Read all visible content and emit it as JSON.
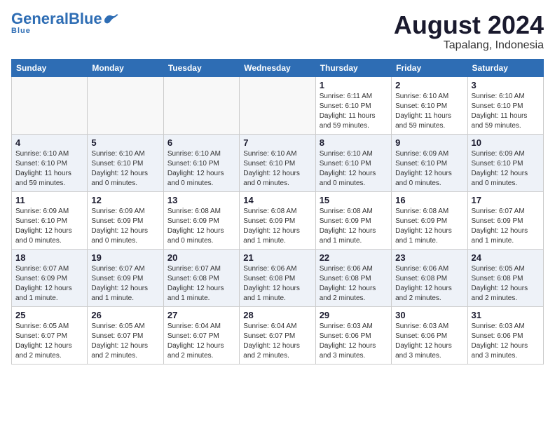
{
  "header": {
    "logo_general": "General",
    "logo_blue": "Blue",
    "month_year": "August 2024",
    "location": "Tapalang, Indonesia"
  },
  "weekdays": [
    "Sunday",
    "Monday",
    "Tuesday",
    "Wednesday",
    "Thursday",
    "Friday",
    "Saturday"
  ],
  "weeks": [
    [
      {
        "day": "",
        "sunrise": "",
        "sunset": "",
        "daylight": ""
      },
      {
        "day": "",
        "sunrise": "",
        "sunset": "",
        "daylight": ""
      },
      {
        "day": "",
        "sunrise": "",
        "sunset": "",
        "daylight": ""
      },
      {
        "day": "",
        "sunrise": "",
        "sunset": "",
        "daylight": ""
      },
      {
        "day": "1",
        "sunrise": "6:11 AM",
        "sunset": "6:10 PM",
        "daylight": "11 hours and 59 minutes."
      },
      {
        "day": "2",
        "sunrise": "6:10 AM",
        "sunset": "6:10 PM",
        "daylight": "11 hours and 59 minutes."
      },
      {
        "day": "3",
        "sunrise": "6:10 AM",
        "sunset": "6:10 PM",
        "daylight": "11 hours and 59 minutes."
      }
    ],
    [
      {
        "day": "4",
        "sunrise": "6:10 AM",
        "sunset": "6:10 PM",
        "daylight": "11 hours and 59 minutes."
      },
      {
        "day": "5",
        "sunrise": "6:10 AM",
        "sunset": "6:10 PM",
        "daylight": "12 hours and 0 minutes."
      },
      {
        "day": "6",
        "sunrise": "6:10 AM",
        "sunset": "6:10 PM",
        "daylight": "12 hours and 0 minutes."
      },
      {
        "day": "7",
        "sunrise": "6:10 AM",
        "sunset": "6:10 PM",
        "daylight": "12 hours and 0 minutes."
      },
      {
        "day": "8",
        "sunrise": "6:10 AM",
        "sunset": "6:10 PM",
        "daylight": "12 hours and 0 minutes."
      },
      {
        "day": "9",
        "sunrise": "6:09 AM",
        "sunset": "6:10 PM",
        "daylight": "12 hours and 0 minutes."
      },
      {
        "day": "10",
        "sunrise": "6:09 AM",
        "sunset": "6:10 PM",
        "daylight": "12 hours and 0 minutes."
      }
    ],
    [
      {
        "day": "11",
        "sunrise": "6:09 AM",
        "sunset": "6:10 PM",
        "daylight": "12 hours and 0 minutes."
      },
      {
        "day": "12",
        "sunrise": "6:09 AM",
        "sunset": "6:09 PM",
        "daylight": "12 hours and 0 minutes."
      },
      {
        "day": "13",
        "sunrise": "6:08 AM",
        "sunset": "6:09 PM",
        "daylight": "12 hours and 0 minutes."
      },
      {
        "day": "14",
        "sunrise": "6:08 AM",
        "sunset": "6:09 PM",
        "daylight": "12 hours and 1 minute."
      },
      {
        "day": "15",
        "sunrise": "6:08 AM",
        "sunset": "6:09 PM",
        "daylight": "12 hours and 1 minute."
      },
      {
        "day": "16",
        "sunrise": "6:08 AM",
        "sunset": "6:09 PM",
        "daylight": "12 hours and 1 minute."
      },
      {
        "day": "17",
        "sunrise": "6:07 AM",
        "sunset": "6:09 PM",
        "daylight": "12 hours and 1 minute."
      }
    ],
    [
      {
        "day": "18",
        "sunrise": "6:07 AM",
        "sunset": "6:09 PM",
        "daylight": "12 hours and 1 minute."
      },
      {
        "day": "19",
        "sunrise": "6:07 AM",
        "sunset": "6:09 PM",
        "daylight": "12 hours and 1 minute."
      },
      {
        "day": "20",
        "sunrise": "6:07 AM",
        "sunset": "6:08 PM",
        "daylight": "12 hours and 1 minute."
      },
      {
        "day": "21",
        "sunrise": "6:06 AM",
        "sunset": "6:08 PM",
        "daylight": "12 hours and 1 minute."
      },
      {
        "day": "22",
        "sunrise": "6:06 AM",
        "sunset": "6:08 PM",
        "daylight": "12 hours and 2 minutes."
      },
      {
        "day": "23",
        "sunrise": "6:06 AM",
        "sunset": "6:08 PM",
        "daylight": "12 hours and 2 minutes."
      },
      {
        "day": "24",
        "sunrise": "6:05 AM",
        "sunset": "6:08 PM",
        "daylight": "12 hours and 2 minutes."
      }
    ],
    [
      {
        "day": "25",
        "sunrise": "6:05 AM",
        "sunset": "6:07 PM",
        "daylight": "12 hours and 2 minutes."
      },
      {
        "day": "26",
        "sunrise": "6:05 AM",
        "sunset": "6:07 PM",
        "daylight": "12 hours and 2 minutes."
      },
      {
        "day": "27",
        "sunrise": "6:04 AM",
        "sunset": "6:07 PM",
        "daylight": "12 hours and 2 minutes."
      },
      {
        "day": "28",
        "sunrise": "6:04 AM",
        "sunset": "6:07 PM",
        "daylight": "12 hours and 2 minutes."
      },
      {
        "day": "29",
        "sunrise": "6:03 AM",
        "sunset": "6:06 PM",
        "daylight": "12 hours and 3 minutes."
      },
      {
        "day": "30",
        "sunrise": "6:03 AM",
        "sunset": "6:06 PM",
        "daylight": "12 hours and 3 minutes."
      },
      {
        "day": "31",
        "sunrise": "6:03 AM",
        "sunset": "6:06 PM",
        "daylight": "12 hours and 3 minutes."
      }
    ]
  ]
}
